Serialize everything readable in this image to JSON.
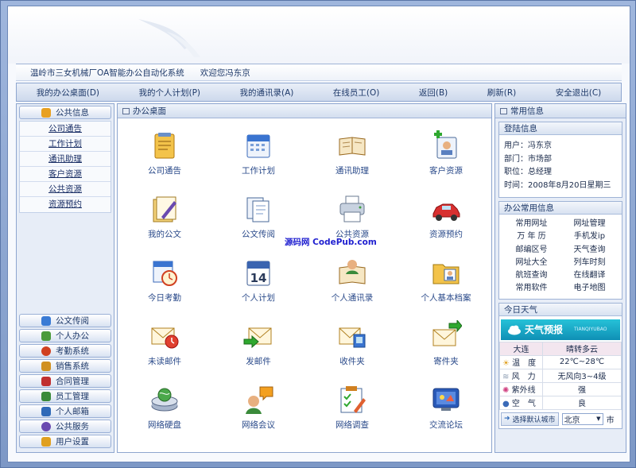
{
  "welcome": {
    "system_title": "温岭市三女机械厂OA智能办公自动化系统",
    "greeting": "欢迎您冯东京"
  },
  "topnav": [
    {
      "label": "我的办公桌面(D)",
      "icon": "desk-icon"
    },
    {
      "label": "我的个人计划(P)",
      "icon": "plan-icon"
    },
    {
      "label": "我的通讯录(A)",
      "icon": "contacts-icon"
    },
    {
      "label": "在线员工(O)",
      "icon": "online-icon"
    },
    {
      "label": "返回(B)",
      "icon": "back-icon"
    },
    {
      "label": "刷新(R)",
      "icon": "refresh-icon"
    },
    {
      "label": "安全退出(C)",
      "icon": "exit-icon"
    }
  ],
  "left": {
    "active_category": "公共信息",
    "sub_items": [
      "公司通告",
      "工作计划",
      "通讯助理",
      "客户资源",
      "公共资源",
      "资源预约"
    ],
    "bottom_categories": [
      {
        "label": "公文传阅",
        "icon": "document-icon",
        "color": "#3a7bd5"
      },
      {
        "label": "个人办公",
        "icon": "person-icon",
        "color": "#4a9a3a"
      },
      {
        "label": "考勤系统",
        "icon": "clock-icon",
        "color": "#d04020"
      },
      {
        "label": "销售系统",
        "icon": "box-icon",
        "color": "#d09020"
      },
      {
        "label": "合同管理",
        "icon": "contract-icon",
        "color": "#c03030"
      },
      {
        "label": "员工管理",
        "icon": "staff-icon",
        "color": "#3a8a3a"
      },
      {
        "label": "个人邮箱",
        "icon": "mail-icon",
        "color": "#2f6ab8"
      },
      {
        "label": "公共服务",
        "icon": "globe-icon",
        "color": "#6a4ab0"
      },
      {
        "label": "用户设置",
        "icon": "user-settings-icon",
        "color": "#e0a020"
      }
    ]
  },
  "main": {
    "title": "办公桌面",
    "watermark": "源码网 CodePub.com",
    "tiles": [
      {
        "label": "公司通告",
        "icon": "notice-icon"
      },
      {
        "label": "工作计划",
        "icon": "calendar-icon"
      },
      {
        "label": "通讯助理",
        "icon": "address-book-icon"
      },
      {
        "label": "客户资源",
        "icon": "customer-icon"
      },
      {
        "label": "我的公文",
        "icon": "my-document-icon"
      },
      {
        "label": "公文传阅",
        "icon": "document-circulate-icon"
      },
      {
        "label": "公共资源",
        "icon": "printer-icon"
      },
      {
        "label": "资源预约",
        "icon": "car-icon"
      },
      {
        "label": "今日考勤",
        "icon": "attendance-icon"
      },
      {
        "label": "个人计划",
        "icon": "calendar-14-icon"
      },
      {
        "label": "个人通讯录",
        "icon": "personal-contacts-icon"
      },
      {
        "label": "个人基本档案",
        "icon": "profile-icon"
      },
      {
        "label": "未读邮件",
        "icon": "unread-mail-icon"
      },
      {
        "label": "发邮件",
        "icon": "send-mail-icon"
      },
      {
        "label": "收件夹",
        "icon": "inbox-icon"
      },
      {
        "label": "寄件夹",
        "icon": "outbox-icon"
      },
      {
        "label": "网络硬盘",
        "icon": "network-disk-icon"
      },
      {
        "label": "网络会议",
        "icon": "meeting-icon"
      },
      {
        "label": "网络调查",
        "icon": "survey-icon"
      },
      {
        "label": "交流论坛",
        "icon": "forum-icon"
      }
    ]
  },
  "right": {
    "title": "常用信息",
    "login": {
      "title": "登陆信息",
      "user": "用户：冯东京",
      "dept": "部门：市场部",
      "position": "职位：总经理",
      "time": "时间：2008年8月20日星期三"
    },
    "links": {
      "title": "办公常用信息",
      "items": [
        "常用网址",
        "网址管理",
        "万 年 历",
        "手机发ip",
        "邮编区号",
        "天气查询",
        "网址大全",
        "列车时刻",
        "航班查询",
        "在线翻译",
        "常用软件",
        "电子地图"
      ]
    },
    "weather": {
      "title": "今日天气",
      "banner": "天气预报",
      "banner_sub": "TIANQIYUBAO",
      "city": "大连",
      "condition": "晴转多云",
      "rows": [
        {
          "k": "温　度",
          "v": "22℃~28℃",
          "icon": "thermometer-icon"
        },
        {
          "k": "风　力",
          "v": "无风向3~4级",
          "icon": "wind-icon"
        },
        {
          "k": "紫外线",
          "v": "强",
          "icon": "sun-icon"
        },
        {
          "k": "空　气",
          "v": "良",
          "icon": "air-icon"
        }
      ],
      "select_city_label": "选择默认城市",
      "selected_city": "北京",
      "city_suffix": "市"
    }
  },
  "colors": {
    "frame": "#7f9bc8",
    "panel": "#e7edf7",
    "accent": "#1f3a6a",
    "weather_banner": "#1aa6c8"
  }
}
